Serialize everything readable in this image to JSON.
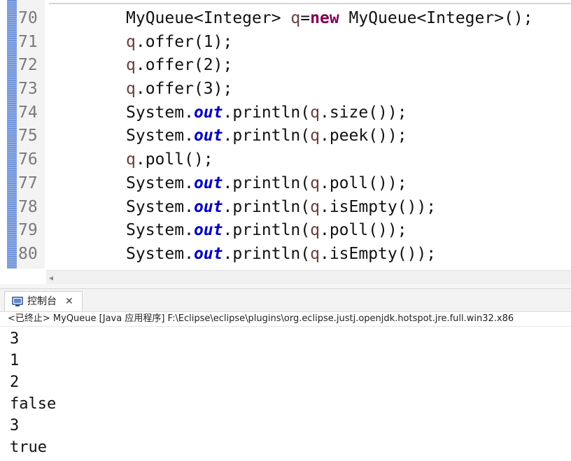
{
  "editor": {
    "lines": [
      {
        "num": "70",
        "parts": [
          {
            "t": "MyQueue<Integer> ",
            "c": "plain"
          },
          {
            "t": "q",
            "c": "var"
          },
          {
            "t": "=",
            "c": "plain"
          },
          {
            "t": "new",
            "c": "kw"
          },
          {
            "t": " MyQueue<Integer>();",
            "c": "plain"
          }
        ]
      },
      {
        "num": "71",
        "parts": [
          {
            "t": "q",
            "c": "var"
          },
          {
            "t": ".offer(1);",
            "c": "plain"
          }
        ]
      },
      {
        "num": "72",
        "parts": [
          {
            "t": "q",
            "c": "var"
          },
          {
            "t": ".offer(2);",
            "c": "plain"
          }
        ]
      },
      {
        "num": "73",
        "parts": [
          {
            "t": "q",
            "c": "var"
          },
          {
            "t": ".offer(3);",
            "c": "plain"
          }
        ]
      },
      {
        "num": "74",
        "parts": [
          {
            "t": "System.",
            "c": "plain"
          },
          {
            "t": "out",
            "c": "field"
          },
          {
            "t": ".println(",
            "c": "plain"
          },
          {
            "t": "q",
            "c": "var"
          },
          {
            "t": ".size());",
            "c": "plain"
          }
        ]
      },
      {
        "num": "75",
        "parts": [
          {
            "t": "System.",
            "c": "plain"
          },
          {
            "t": "out",
            "c": "field"
          },
          {
            "t": ".println(",
            "c": "plain"
          },
          {
            "t": "q",
            "c": "var"
          },
          {
            "t": ".peek());",
            "c": "plain"
          }
        ]
      },
      {
        "num": "76",
        "parts": [
          {
            "t": "q",
            "c": "var"
          },
          {
            "t": ".poll();",
            "c": "plain"
          }
        ]
      },
      {
        "num": "77",
        "parts": [
          {
            "t": "System.",
            "c": "plain"
          },
          {
            "t": "out",
            "c": "field"
          },
          {
            "t": ".println(",
            "c": "plain"
          },
          {
            "t": "q",
            "c": "var"
          },
          {
            "t": ".poll());",
            "c": "plain"
          }
        ]
      },
      {
        "num": "78",
        "parts": [
          {
            "t": "System.",
            "c": "plain"
          },
          {
            "t": "out",
            "c": "field"
          },
          {
            "t": ".println(",
            "c": "plain"
          },
          {
            "t": "q",
            "c": "var"
          },
          {
            "t": ".isEmpty());",
            "c": "plain"
          }
        ]
      },
      {
        "num": "79",
        "parts": [
          {
            "t": "System.",
            "c": "plain"
          },
          {
            "t": "out",
            "c": "field"
          },
          {
            "t": ".println(",
            "c": "plain"
          },
          {
            "t": "q",
            "c": "var"
          },
          {
            "t": ".poll());",
            "c": "plain"
          }
        ]
      },
      {
        "num": "80",
        "parts": [
          {
            "t": "System.",
            "c": "plain"
          },
          {
            "t": "out",
            "c": "field"
          },
          {
            "t": ".println(",
            "c": "plain"
          },
          {
            "t": "q",
            "c": "var"
          },
          {
            "t": ".isEmpty());",
            "c": "plain"
          }
        ]
      }
    ],
    "scroll_left_glyph": "◂"
  },
  "console": {
    "tab_label": "控制台",
    "tab_close": "✕",
    "status": "<已终止> MyQueue [Java 应用程序] F:\\Eclipse\\eclipse\\plugins\\org.eclipse.justj.openjdk.hotspot.jre.full.win32.x86",
    "output": [
      "3",
      "1",
      "2",
      "false",
      "3",
      "true"
    ]
  },
  "icons": {
    "console": "console-icon"
  },
  "colors": {
    "keyword": "#7f0055",
    "variable": "#6a3e3e",
    "static_field": "#0000c0",
    "gutter_marker": "#6f93d8"
  }
}
